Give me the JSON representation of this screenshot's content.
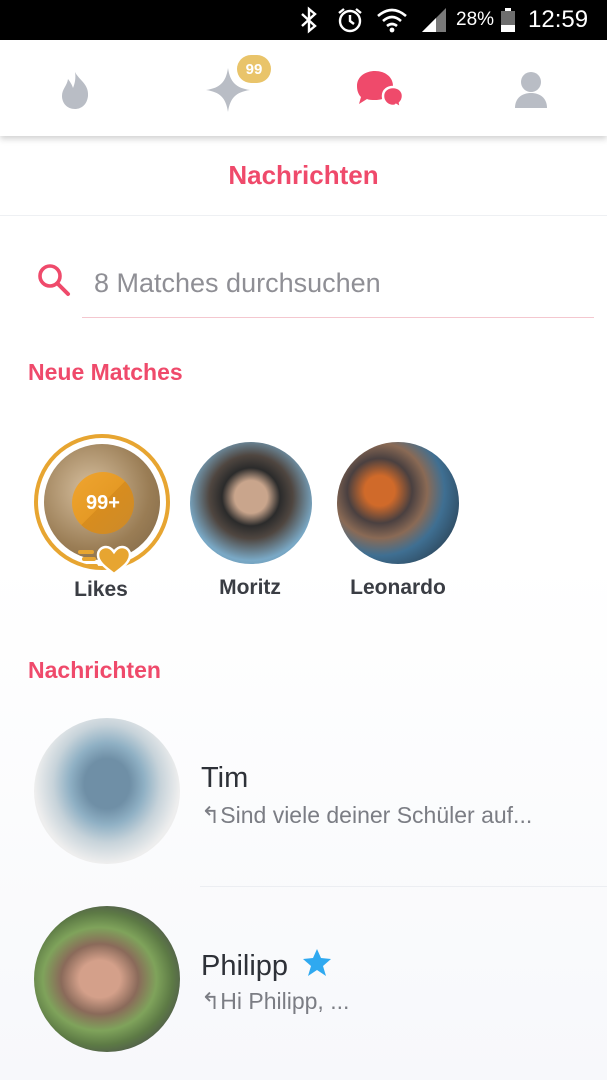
{
  "status_bar": {
    "battery": "28%",
    "time": "12:59",
    "icons": [
      "bluetooth-icon",
      "alarm-icon",
      "wifi-icon",
      "signal-icon",
      "battery-icon"
    ]
  },
  "nav": {
    "tabs": [
      "flame-icon",
      "sparkle-icon",
      "chat-bubbles-icon",
      "profile-icon"
    ],
    "badge": "99",
    "active_color": "#ef4a6b",
    "inactive_color": "#b8bcc4"
  },
  "header": {
    "title": "Nachrichten"
  },
  "search": {
    "placeholder": "8 Matches durchsuchen",
    "value": ""
  },
  "new_matches": {
    "label": "Neue Matches",
    "likes": {
      "count": "99+",
      "label": "Likes"
    },
    "items": [
      {
        "name": "Moritz"
      },
      {
        "name": "Leonardo"
      }
    ]
  },
  "messages": {
    "label": "Nachrichten",
    "items": [
      {
        "name": "Tim",
        "preview": "↰Sind viele deiner Schüler auf...",
        "verified": false
      },
      {
        "name": "Philipp",
        "preview": "↰Hi Philipp, ...",
        "verified": true
      }
    ]
  },
  "colors": {
    "brand": "#ef4a6b",
    "gold": "#e7a531",
    "verified": "#2fa9f0"
  }
}
